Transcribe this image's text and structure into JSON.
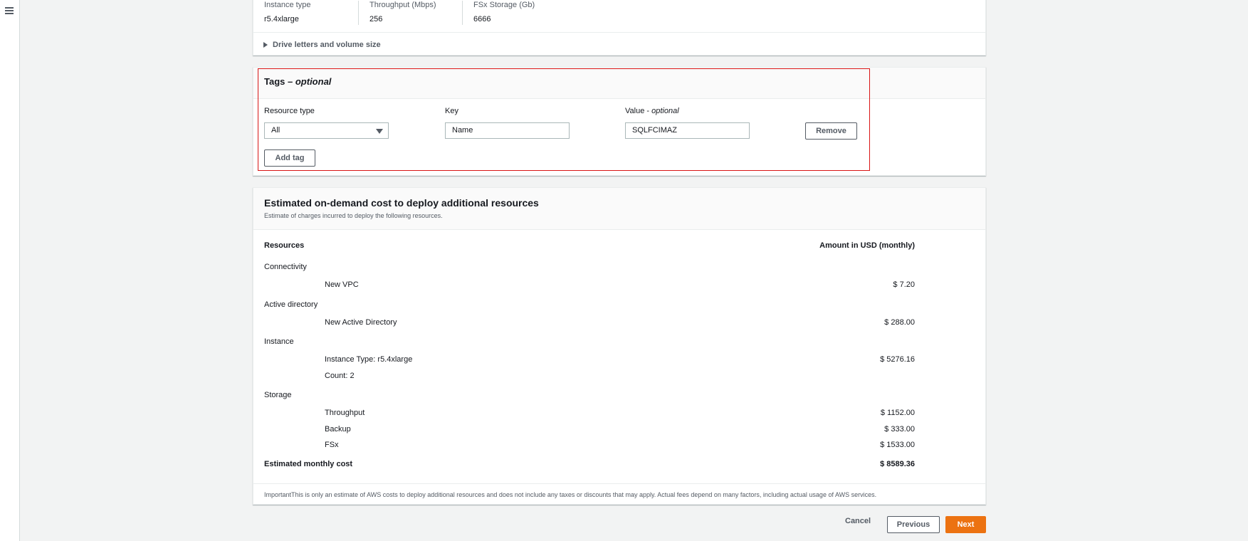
{
  "summary": {
    "instance_type_label": "Instance type",
    "instance_type_value": "r5.4xlarge",
    "throughput_label": "Throughput (Mbps)",
    "throughput_value": "256",
    "storage_label": "FSx Storage (Gb)",
    "storage_value": "6666",
    "expander_label": "Drive letters and volume size"
  },
  "tags": {
    "title": "Tags",
    "title_sep": " – ",
    "title_optional": "optional",
    "resource_type_label": "Resource type",
    "resource_type_value": "All",
    "key_label": "Key",
    "key_value": "Name",
    "value_label": "Value",
    "value_label_sep": " - ",
    "value_label_optional": "optional",
    "value_value": "SQLFCIMAZ",
    "remove_label": "Remove",
    "add_tag_label": "Add tag"
  },
  "cost": {
    "title": "Estimated on-demand cost to deploy additional resources",
    "subtitle": "Estimate of charges incurred to deploy the following resources.",
    "col_resources": "Resources",
    "col_amount": "Amount in USD (monthly)",
    "groups": [
      {
        "name": "Connectivity",
        "items": [
          {
            "label": "New VPC",
            "amount": "$ 7.20"
          }
        ]
      },
      {
        "name": "Active directory",
        "items": [
          {
            "label": "New Active Directory",
            "amount": "$ 288.00"
          }
        ]
      },
      {
        "name": "Instance",
        "items": [
          {
            "label": "Instance Type: r5.4xlarge",
            "amount": "$ 5276.16"
          },
          {
            "label": "Count: 2",
            "amount": ""
          }
        ]
      },
      {
        "name": "Storage",
        "items": [
          {
            "label": "Throughput",
            "amount": "$ 1152.00"
          },
          {
            "label": "Backup",
            "amount": "$ 333.00"
          },
          {
            "label": "FSx",
            "amount": "$ 1533.00"
          }
        ]
      }
    ],
    "total_label": "Estimated monthly cost",
    "total_amount": "$ 8589.36",
    "footnote": "ImportantThis is only an estimate of AWS costs to deploy additional resources and does not include any taxes or discounts that may apply. Actual fees depend on many factors, including actual usage of AWS services."
  },
  "footer": {
    "cancel_label": "Cancel",
    "previous_label": "Previous",
    "next_label": "Next"
  },
  "colors": {
    "primary": "#ec7211",
    "highlight": "#d91515",
    "text": "#16191f",
    "muted": "#545b64"
  },
  "icons": [
    "menu-icon",
    "caret-right-icon",
    "caret-down-icon"
  ]
}
